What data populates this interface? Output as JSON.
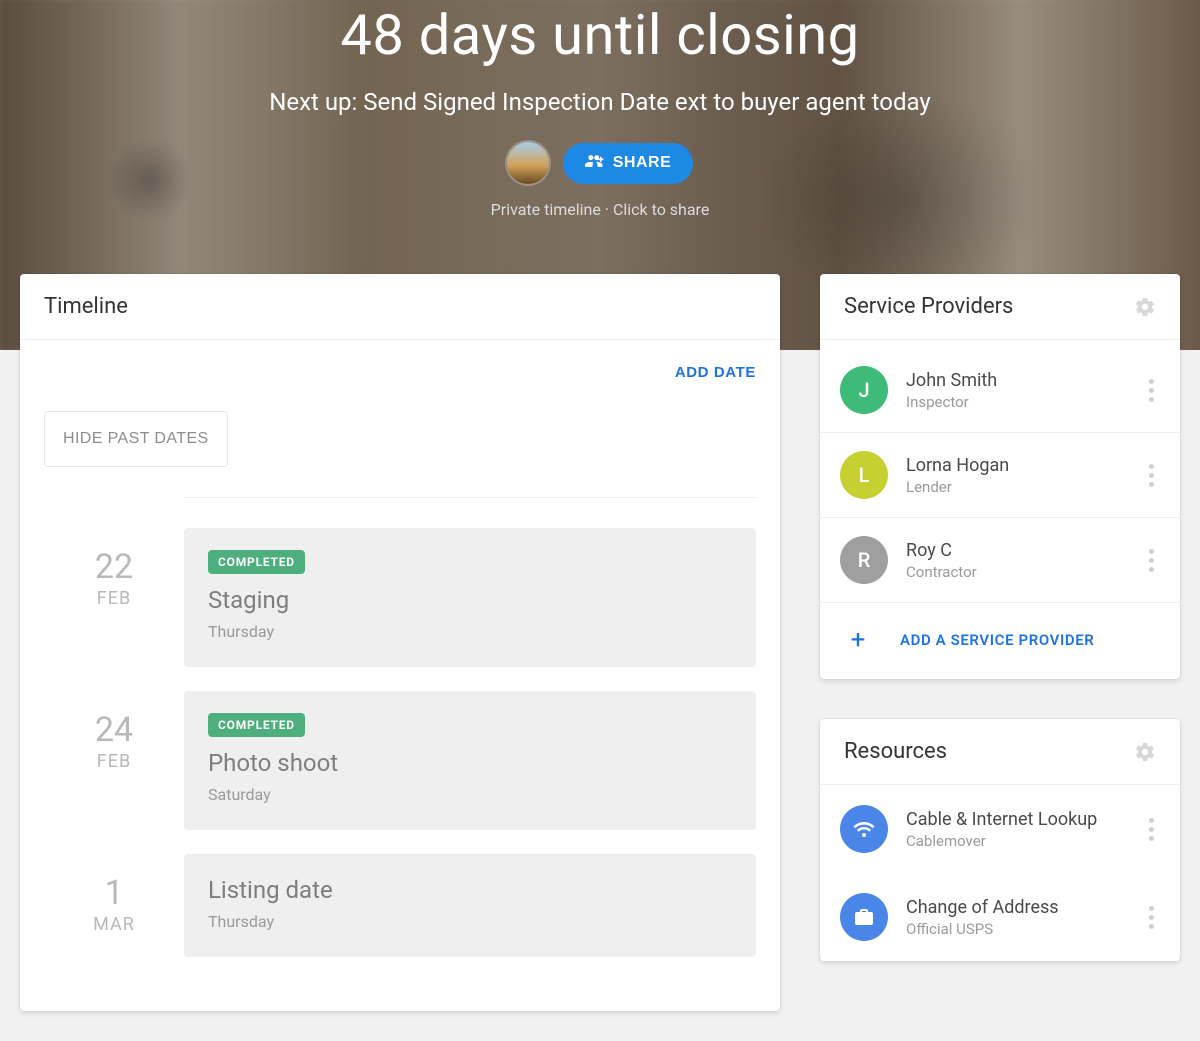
{
  "hero": {
    "title": "48 days until closing",
    "subtitle": "Next up: Send Signed Inspection Date ext to buyer agent today",
    "share_label": "SHARE",
    "privacy_text": "Private timeline · Click to share"
  },
  "timeline": {
    "heading": "Timeline",
    "add_date_label": "ADD DATE",
    "hide_past_label": "HIDE PAST DATES",
    "events": [
      {
        "day": "22",
        "month": "FEB",
        "status": "COMPLETED",
        "title": "Staging",
        "weekday": "Thursday",
        "completed": true
      },
      {
        "day": "24",
        "month": "FEB",
        "status": "COMPLETED",
        "title": "Photo shoot",
        "weekday": "Saturday",
        "completed": true
      },
      {
        "day": "1",
        "month": "MAR",
        "status": "",
        "title": "Listing date",
        "weekday": "Thursday",
        "completed": false
      }
    ]
  },
  "providers": {
    "heading": "Service Providers",
    "add_label": "ADD A SERVICE PROVIDER",
    "items": [
      {
        "initial": "J",
        "name": "John Smith",
        "role": "Inspector",
        "color": "#3fbb79"
      },
      {
        "initial": "L",
        "name": "Lorna Hogan",
        "role": "Lender",
        "color": "#c6d131"
      },
      {
        "initial": "R",
        "name": "Roy C",
        "role": "Contractor",
        "color": "#9f9f9f"
      }
    ]
  },
  "resources": {
    "heading": "Resources",
    "items": [
      {
        "icon": "wifi-icon",
        "name": "Cable & Internet Lookup",
        "sub": "Cablemover"
      },
      {
        "icon": "briefcase-icon",
        "name": "Change of Address",
        "sub": "Official USPS"
      }
    ]
  }
}
